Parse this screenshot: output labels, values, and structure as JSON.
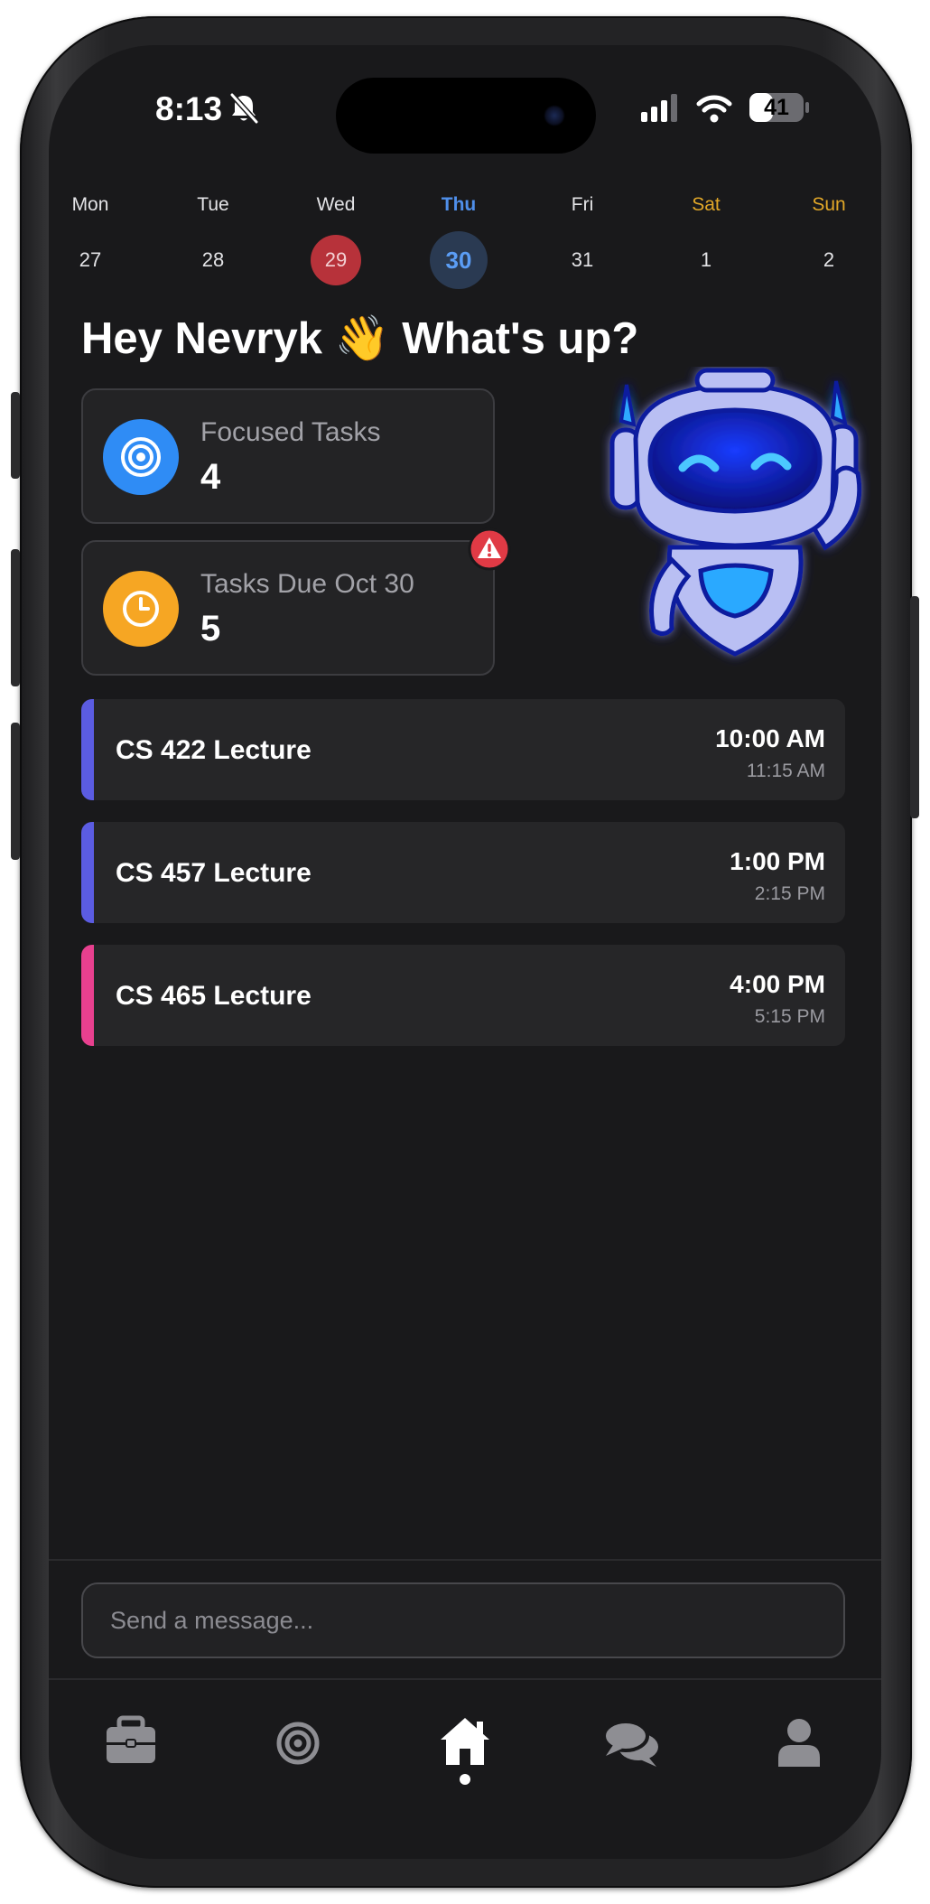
{
  "status_bar": {
    "time": "8:13",
    "battery": "41"
  },
  "week": [
    {
      "day": "Mon",
      "date": "27",
      "state": "normal"
    },
    {
      "day": "Tue",
      "date": "28",
      "state": "normal"
    },
    {
      "day": "Wed",
      "date": "29",
      "state": "past"
    },
    {
      "day": "Thu",
      "date": "30",
      "state": "today"
    },
    {
      "day": "Fri",
      "date": "31",
      "state": "normal"
    },
    {
      "day": "Sat",
      "date": "1",
      "state": "weekend"
    },
    {
      "day": "Sun",
      "date": "2",
      "state": "weekend"
    }
  ],
  "greeting": "Hey Nevryk 👋 What's up?",
  "cards": {
    "focused": {
      "title": "Focused Tasks",
      "value": "4",
      "icon": "target-icon"
    },
    "due": {
      "title": "Tasks Due Oct 30",
      "value": "5",
      "icon": "clock-icon",
      "alert_icon": "warning-icon"
    }
  },
  "events": [
    {
      "name": "CS 422 Lecture",
      "start": "10:00 AM",
      "end": "11:15 AM",
      "color": "#5b5ce2"
    },
    {
      "name": "CS 457 Lecture",
      "start": "1:00 PM",
      "end": "2:15 PM",
      "color": "#5b5ce2"
    },
    {
      "name": "CS 465 Lecture",
      "start": "4:00 PM",
      "end": "5:15 PM",
      "color": "#e8408f"
    }
  ],
  "message": {
    "placeholder": "Send a message..."
  },
  "tabs": [
    {
      "icon": "briefcase-icon",
      "active": false
    },
    {
      "icon": "target-icon",
      "active": false
    },
    {
      "icon": "home-icon",
      "active": true
    },
    {
      "icon": "chat-icon",
      "active": false
    },
    {
      "icon": "user-icon",
      "active": false
    }
  ],
  "colors": {
    "background": "#19191b",
    "accent_blue": "#4f8fea",
    "weekend": "#e1a728",
    "past_day": "#b7323a",
    "focused_icon": "#2f8cf5",
    "due_icon": "#f6a623"
  }
}
